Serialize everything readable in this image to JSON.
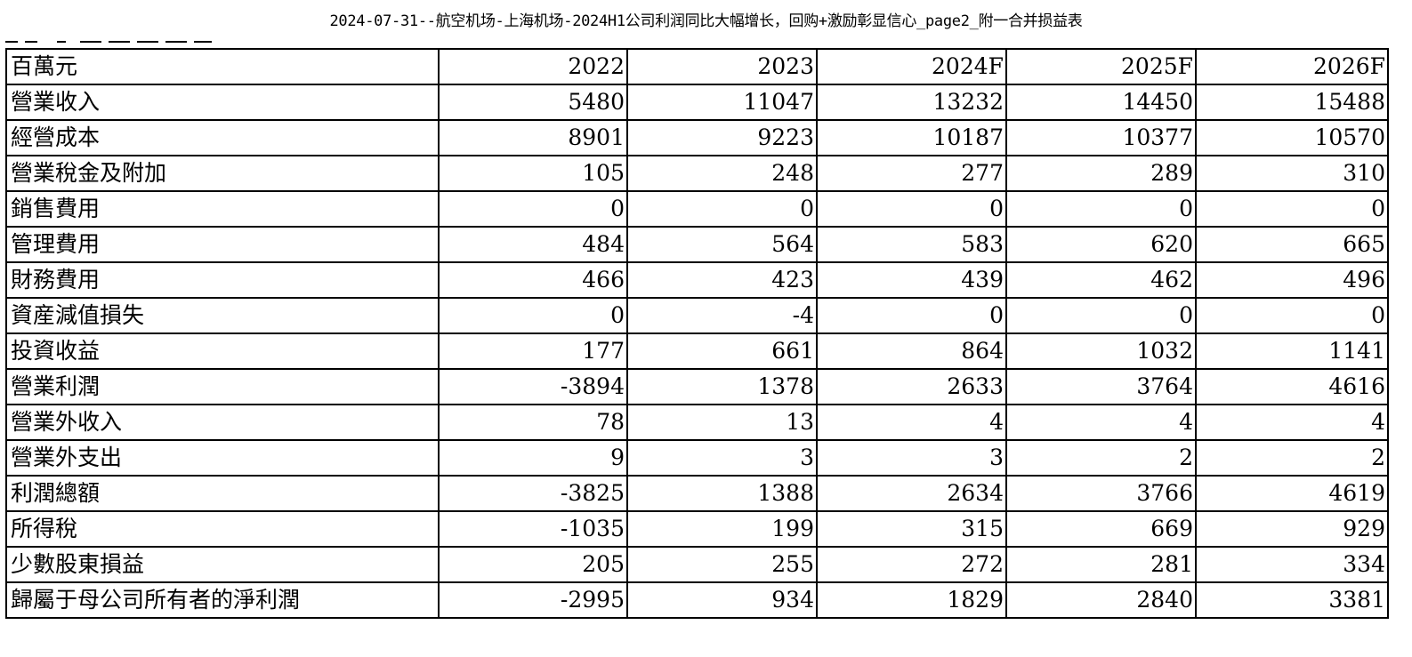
{
  "document": {
    "title": "2024-07-31--航空机场-上海机场-2024H1公司利润同比大幅增长，回购+激励彰显信心_page2_附一合并损益表"
  },
  "table": {
    "header": [
      "百萬元",
      "2022",
      "2023",
      "2024F",
      "2025F",
      "2026F"
    ],
    "rows": [
      [
        "營業收入",
        "5480",
        "11047",
        "13232",
        "14450",
        "15488"
      ],
      [
        "經營成本",
        "8901",
        "9223",
        "10187",
        "10377",
        "10570"
      ],
      [
        "營業稅金及附加",
        "105",
        "248",
        "277",
        "289",
        "310"
      ],
      [
        "銷售費用",
        "0",
        "0",
        "0",
        "0",
        "0"
      ],
      [
        "管理費用",
        "484",
        "564",
        "583",
        "620",
        "665"
      ],
      [
        "財務費用",
        "466",
        "423",
        "439",
        "462",
        "496"
      ],
      [
        "資産減值損失",
        "0",
        "-4",
        "0",
        "0",
        "0"
      ],
      [
        "投資收益",
        "177",
        "661",
        "864",
        "1032",
        "1141"
      ],
      [
        "營業利潤",
        "-3894",
        "1378",
        "2633",
        "3764",
        "4616"
      ],
      [
        "營業外收入",
        "78",
        "13",
        "4",
        "4",
        "4"
      ],
      [
        "營業外支出",
        "9",
        "3",
        "3",
        "2",
        "2"
      ],
      [
        "利潤總額",
        "-3825",
        "1388",
        "2634",
        "3766",
        "4619"
      ],
      [
        "所得稅",
        "-1035",
        "199",
        "315",
        "669",
        "929"
      ],
      [
        "少數股東損益",
        "205",
        "255",
        "272",
        "281",
        "334"
      ],
      [
        "歸屬于母公司所有者的淨利潤",
        "-2995",
        "934",
        "1829",
        "2840",
        "3381"
      ]
    ]
  }
}
